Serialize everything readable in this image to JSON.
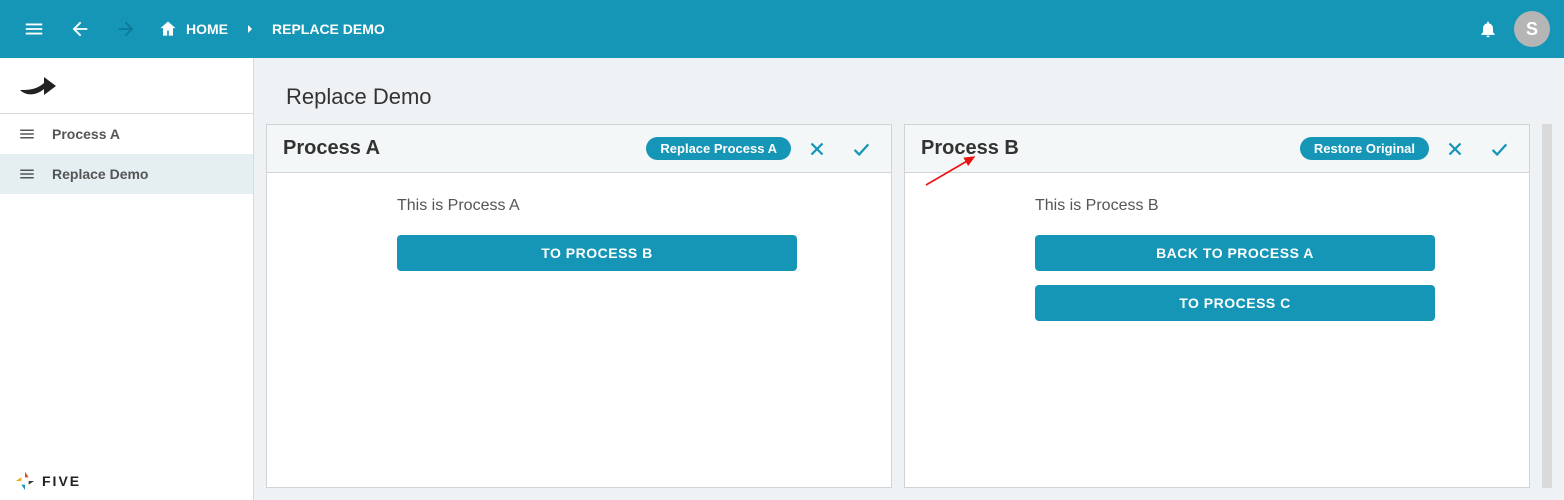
{
  "topbar": {
    "home_label": "HOME",
    "crumb_label": "REPLACE DEMO",
    "avatar_letter": "S"
  },
  "sidebar": {
    "items": [
      {
        "label": "Process A"
      },
      {
        "label": "Replace Demo"
      }
    ],
    "footer_brand": "FIVE"
  },
  "main": {
    "title": "Replace Demo"
  },
  "panel_a": {
    "title": "Process A",
    "chip_label": "Replace Process A",
    "body_text": "This is Process A",
    "button1_label": "TO PROCESS B"
  },
  "panel_b": {
    "title": "Process B",
    "chip_label": "Restore Original",
    "body_text": "This is Process B",
    "button1_label": "BACK TO PROCESS A",
    "button2_label": "TO PROCESS C"
  }
}
